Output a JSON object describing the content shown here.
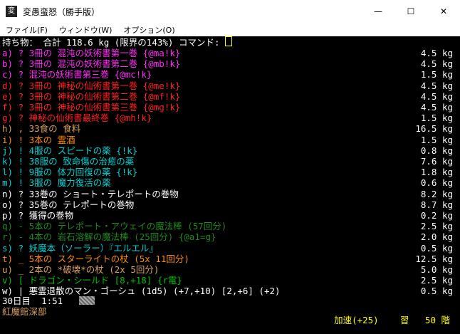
{
  "window": {
    "title": "変愚蛮怒（勝手版）",
    "icon_label": "変"
  },
  "controls": {
    "minimize": "—",
    "maximize": "☐",
    "close": "✕"
  },
  "menu": [
    {
      "label": "ファイル(F)"
    },
    {
      "label": "ウィンドウ(W)"
    },
    {
      "label": "オプション(O)"
    }
  ],
  "header": {
    "text": "持ち物： 合計 118.6 kg (限界の143%) コマンド:"
  },
  "items": [
    {
      "text": "a) ? 3冊の 混沌の妖術書第一巻 {@ma!k}",
      "weight": "4.5 kg",
      "color": "#ff2df5"
    },
    {
      "text": "b) ? 3冊の 混沌の妖術書第二巻 {@mb!k}",
      "weight": "4.5 kg",
      "color": "#ff2df5"
    },
    {
      "text": "c) ? 混沌の妖術書第三巻 {@mc!k}",
      "weight": "1.5 kg",
      "color": "#ff2df5"
    },
    {
      "text": "d) ? 3冊の 神秘の仙術書第一巻 {@me!k}",
      "weight": "4.5 kg",
      "color": "#ff2020"
    },
    {
      "text": "e) ? 3冊の 神秘の仙術書第二巻 {@mf!k}",
      "weight": "4.5 kg",
      "color": "#ff2020"
    },
    {
      "text": "f) ? 3冊の 神秘の仙術書第三巻 {@mg!k}",
      "weight": "4.5 kg",
      "color": "#ff2020"
    },
    {
      "text": "g) ? 神秘の仙術書最終巻 {@mh!k}",
      "weight": "1.5 kg",
      "color": "#ff2020"
    },
    {
      "text": "h) , 33食の 食料",
      "weight": "16.5 kg",
      "color": "#d8a060"
    },
    {
      "text": "i) ! 3本の 霊酒",
      "weight": "1.5 kg",
      "color": "#ff8c00"
    },
    {
      "text": "j) ! 4服の スピードの薬 {!k}",
      "weight": "0.8 kg",
      "color": "#00d0d0"
    },
    {
      "text": "k) ! 38服の 致命傷の治癒の薬",
      "weight": "7.6 kg",
      "color": "#00d0d0"
    },
    {
      "text": "l) ! 9服の 体力回復の薬 {!k}",
      "weight": "1.8 kg",
      "color": "#00d0d0"
    },
    {
      "text": "m) ! 3服の 魔力復活の薬",
      "weight": "0.6 kg",
      "color": "#00d0d0"
    },
    {
      "text": "n) ? 33巻の ショート・テレポートの巻物",
      "weight": "8.2 kg",
      "color": "#ffffff"
    },
    {
      "text": "o) ? 35巻の テレポートの巻物",
      "weight": "8.7 kg",
      "color": "#ffffff"
    },
    {
      "text": "p) ? 獲得の巻物",
      "weight": "0.2 kg",
      "color": "#ffffff"
    },
    {
      "text": "q) - 5本の テレポート・アウェイの魔法棒 (57回分)",
      "weight": "2.5 kg",
      "color": "#1e8a1e"
    },
    {
      "text": "r) - 4本の 岩石溶解の魔法棒 (25回分) {@a1=g}",
      "weight": "2.0 kg",
      "color": "#1e8a1e"
    },
    {
      "text": "s) ? 妖魔本（ソーラー）『エルエル』",
      "weight": "0.5 kg",
      "color": "#00d0d0"
    },
    {
      "text": "t) _ 5本の スターライトの杖 (5x 11回分)",
      "weight": "12.5 kg",
      "color": "#ff8c00"
    },
    {
      "text": "u) _ 2本の *破壊*の杖 (2x 5回分)",
      "weight": "5.0 kg",
      "color": "#d8a060"
    },
    {
      "text": "v) [ ドラゴン・シールド [8,+18] {r電}",
      "weight": "2.5 kg",
      "color": "#00c000"
    },
    {
      "text": "w) | 悪霊退散のマン・ゴーシュ (1d5) (+7,+10) [2,+6] (+2)",
      "weight": "0.5 kg",
      "color": "#ffffff"
    }
  ],
  "status": {
    "day_time": "30日目  1:51",
    "location": "紅魔館深部",
    "speed": "加速(+25)",
    "study": "習",
    "level": "50 階"
  }
}
